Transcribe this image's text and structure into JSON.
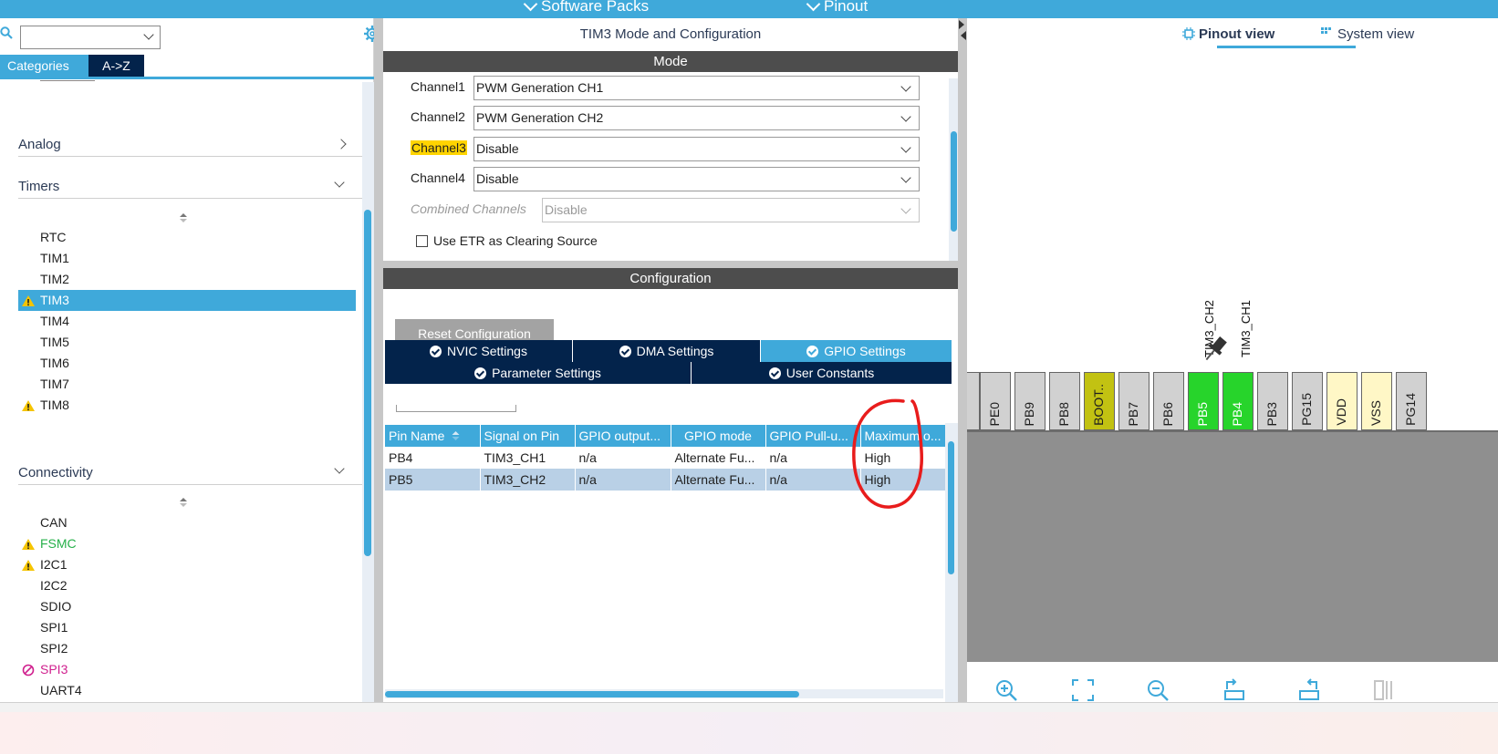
{
  "topbar": {
    "software_packs": "Software Packs",
    "pinout": "Pinout"
  },
  "left": {
    "tabs": {
      "categories": "Categories",
      "az": "A->Z"
    },
    "sections": {
      "analog": "Analog",
      "timers": "Timers",
      "connectivity": "Connectivity"
    },
    "timers": [
      "RTC",
      "TIM1",
      "TIM2",
      "TIM3",
      "TIM4",
      "TIM5",
      "TIM6",
      "TIM7",
      "TIM8"
    ],
    "connectivity": [
      "CAN",
      "FSMC",
      "I2C1",
      "I2C2",
      "SDIO",
      "SPI1",
      "SPI2",
      "SPI3",
      "UART4"
    ]
  },
  "mid": {
    "title": "TIM3 Mode and Configuration",
    "mode_header": "Mode",
    "rows": [
      {
        "label": "Channel1",
        "value": "PWM Generation CH1"
      },
      {
        "label": "Channel2",
        "value": "PWM Generation CH2"
      },
      {
        "label": "Channel3",
        "value": "Disable"
      },
      {
        "label": "Channel4",
        "value": "Disable"
      },
      {
        "label": "Combined Channels",
        "value": "Disable"
      }
    ],
    "etr_checkbox": "Use ETR as Clearing Source",
    "config_header": "Configuration",
    "reset_button": "Reset Configuration",
    "tabs_row1": [
      "NVIC Settings",
      "DMA Settings",
      "GPIO Settings"
    ],
    "tabs_row2": [
      "Parameter Settings",
      "User Constants"
    ],
    "table": {
      "headers": [
        "Pin Name",
        "Signal on Pin",
        "GPIO output...",
        "GPIO mode",
        "GPIO Pull-u...",
        "Maximum o..."
      ],
      "rows": [
        [
          "PB4",
          "TIM3_CH1",
          "n/a",
          "Alternate Fu...",
          "n/a",
          "High"
        ],
        [
          "PB5",
          "TIM3_CH2",
          "n/a",
          "Alternate Fu...",
          "n/a",
          "High"
        ]
      ]
    }
  },
  "right": {
    "pinout_view": "Pinout view",
    "system_view": "System view",
    "signals": [
      "TIM3_CH2",
      "TIM3_CH1"
    ],
    "pins": [
      "PE0",
      "PB9",
      "PB8",
      "BOOT..",
      "PB7",
      "PB6",
      "PB5",
      "PB4",
      "PB3",
      "PG15",
      "VDD",
      "VSS",
      "PG14"
    ]
  },
  "colors": {
    "accent": "#3fa9da",
    "dark_tab": "#03234b",
    "active_pin": "#27d42b",
    "warning": "#f5c400",
    "error": "#d0208e"
  }
}
